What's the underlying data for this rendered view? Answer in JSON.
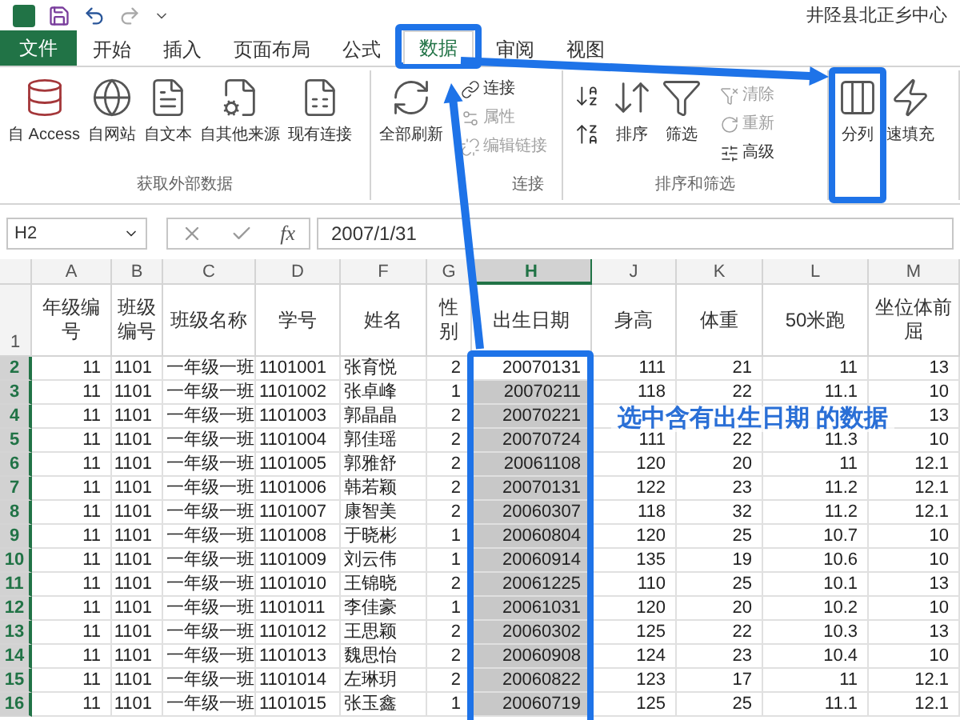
{
  "window": {
    "title": "井陉县北正乡中心"
  },
  "tabs": [
    {
      "label": "文件",
      "kind": "file",
      "selected": false,
      "highlighted": false
    },
    {
      "label": "开始",
      "kind": "tab",
      "selected": false,
      "highlighted": false
    },
    {
      "label": "插入",
      "kind": "tab",
      "selected": false,
      "highlighted": false
    },
    {
      "label": "页面布局",
      "kind": "tab",
      "selected": false,
      "highlighted": false
    },
    {
      "label": "公式",
      "kind": "tab",
      "selected": false,
      "highlighted": false
    },
    {
      "label": "数据",
      "kind": "tab",
      "selected": true,
      "highlighted": true
    },
    {
      "label": "审阅",
      "kind": "tab",
      "selected": false,
      "highlighted": false
    },
    {
      "label": "视图",
      "kind": "tab",
      "selected": false,
      "highlighted": false
    }
  ],
  "ribbon": [
    {
      "label": "获取外部数据",
      "items": [
        {
          "kind": "large",
          "label": "自 Access",
          "disabled": false,
          "highlighted": false
        },
        {
          "kind": "large",
          "label": "自网站",
          "disabled": false,
          "highlighted": false
        },
        {
          "kind": "large",
          "label": "自文本",
          "disabled": false,
          "highlighted": false
        },
        {
          "kind": "large",
          "label": "自其他来源",
          "disabled": false,
          "highlighted": false
        },
        {
          "kind": "large",
          "label": "现有连接",
          "disabled": false,
          "highlighted": false
        }
      ]
    },
    {
      "label": "连接",
      "items": [
        {
          "kind": "large",
          "label": "全部刷新",
          "disabled": false,
          "highlighted": false
        },
        {
          "kind": "small",
          "label": "连接",
          "disabled": false,
          "highlighted": false
        },
        {
          "kind": "small",
          "label": "属性",
          "disabled": true,
          "highlighted": false
        },
        {
          "kind": "small",
          "label": "编辑链接",
          "disabled": true,
          "highlighted": false
        }
      ]
    },
    {
      "label": "排序和筛选",
      "items": [
        {
          "kind": "sort",
          "disabled": false,
          "highlighted": false
        },
        {
          "kind": "large",
          "label": "排序",
          "disabled": false,
          "highlighted": false
        },
        {
          "kind": "large",
          "label": "筛选",
          "disabled": false,
          "highlighted": false
        },
        {
          "kind": "small",
          "label": "清除",
          "disabled": true,
          "highlighted": false
        },
        {
          "kind": "small",
          "label": "重新",
          "disabled": true,
          "highlighted": false
        },
        {
          "kind": "small",
          "label": "高级",
          "disabled": false,
          "highlighted": false
        }
      ]
    },
    {
      "items": [
        {
          "kind": "large",
          "label": "分列",
          "disabled": false,
          "highlighted": true
        },
        {
          "kind": "large",
          "label": "速填充",
          "disabled": false,
          "highlighted": false
        }
      ]
    }
  ],
  "formula_bar": {
    "name_box": "H2",
    "function_label": "fx",
    "value": "2007/1/31"
  },
  "header_row_num": "1",
  "columns": [
    {
      "letter": "A",
      "header": "年级编号",
      "selected": false,
      "highlighted": false
    },
    {
      "letter": "B",
      "header": "班级编号",
      "selected": false,
      "highlighted": false
    },
    {
      "letter": "C",
      "header": "班级名称",
      "selected": false,
      "highlighted": false
    },
    {
      "letter": "D",
      "header": "学号",
      "selected": false,
      "highlighted": false
    },
    {
      "letter": "F",
      "header": "姓名",
      "selected": false,
      "highlighted": false
    },
    {
      "letter": "G",
      "header": "性别",
      "selected": false,
      "highlighted": false
    },
    {
      "letter": "H",
      "header": "出生日期",
      "selected": true,
      "highlighted": true
    },
    {
      "letter": "J",
      "header": "身高",
      "selected": false,
      "highlighted": false
    },
    {
      "letter": "K",
      "header": "体重",
      "selected": false,
      "highlighted": false
    },
    {
      "letter": "L",
      "header": "50米跑",
      "selected": false,
      "highlighted": false
    },
    {
      "letter": "M",
      "header": "坐位体前屈",
      "selected": false,
      "highlighted": false
    }
  ],
  "rows": [
    {
      "num": "2",
      "selected": true,
      "active": true,
      "cells": [
        "11",
        "1101",
        "一年级一班",
        "1101001",
        "张育悦",
        "2",
        "20070131",
        "111",
        "21",
        "11",
        "13"
      ]
    },
    {
      "num": "3",
      "selected": true,
      "active": false,
      "cells": [
        "11",
        "1101",
        "一年级一班",
        "1101002",
        "张卓峰",
        "1",
        "20070211",
        "118",
        "22",
        "11.1",
        "10"
      ]
    },
    {
      "num": "4",
      "selected": true,
      "active": false,
      "cells": [
        "11",
        "1101",
        "一年级一班",
        "1101003",
        "郭晶晶",
        "2",
        "20070221",
        "",
        "",
        "",
        "13"
      ]
    },
    {
      "num": "5",
      "selected": true,
      "active": false,
      "cells": [
        "11",
        "1101",
        "一年级一班",
        "1101004",
        "郭佳瑶",
        "2",
        "20070724",
        "111",
        "22",
        "11.3",
        "10"
      ]
    },
    {
      "num": "6",
      "selected": true,
      "active": false,
      "cells": [
        "11",
        "1101",
        "一年级一班",
        "1101005",
        "郭雅舒",
        "2",
        "20061108",
        "120",
        "20",
        "11",
        "12.1"
      ]
    },
    {
      "num": "7",
      "selected": true,
      "active": false,
      "cells": [
        "11",
        "1101",
        "一年级一班",
        "1101006",
        "韩若颖",
        "2",
        "20070131",
        "122",
        "23",
        "11.2",
        "12.1"
      ]
    },
    {
      "num": "8",
      "selected": true,
      "active": false,
      "cells": [
        "11",
        "1101",
        "一年级一班",
        "1101007",
        "康智美",
        "2",
        "20060307",
        "118",
        "32",
        "11.2",
        "12.1"
      ]
    },
    {
      "num": "9",
      "selected": true,
      "active": false,
      "cells": [
        "11",
        "1101",
        "一年级一班",
        "1101008",
        "于晓彬",
        "1",
        "20060804",
        "120",
        "25",
        "10.7",
        "10"
      ]
    },
    {
      "num": "10",
      "selected": true,
      "active": false,
      "cells": [
        "11",
        "1101",
        "一年级一班",
        "1101009",
        "刘云伟",
        "1",
        "20060914",
        "135",
        "19",
        "10.6",
        "10"
      ]
    },
    {
      "num": "11",
      "selected": true,
      "active": false,
      "cells": [
        "11",
        "1101",
        "一年级一班",
        "1101010",
        "王锦晓",
        "2",
        "20061225",
        "110",
        "25",
        "10.1",
        "13"
      ]
    },
    {
      "num": "12",
      "selected": true,
      "active": false,
      "cells": [
        "11",
        "1101",
        "一年级一班",
        "1101011",
        "李佳豪",
        "1",
        "20061031",
        "120",
        "20",
        "10.2",
        "10"
      ]
    },
    {
      "num": "13",
      "selected": true,
      "active": false,
      "cells": [
        "11",
        "1101",
        "一年级一班",
        "1101012",
        "王思颖",
        "2",
        "20060302",
        "125",
        "22",
        "10.3",
        "13"
      ]
    },
    {
      "num": "14",
      "selected": true,
      "active": false,
      "cells": [
        "11",
        "1101",
        "一年级一班",
        "1101013",
        "魏思怡",
        "2",
        "20060908",
        "124",
        "23",
        "10.4",
        "10"
      ]
    },
    {
      "num": "15",
      "selected": true,
      "active": false,
      "cells": [
        "11",
        "1101",
        "一年级一班",
        "1101014",
        "左琳玥",
        "2",
        "20060822",
        "123",
        "17",
        "11",
        "12.1"
      ]
    },
    {
      "num": "16",
      "selected": true,
      "active": false,
      "cells": [
        "11",
        "1101",
        "一年级一班",
        "1101015",
        "张玉鑫",
        "1",
        "20060719",
        "125",
        "25",
        "11.1",
        "12.1"
      ]
    }
  ],
  "annotation": {
    "text": "选中含有出生日期 的数据"
  }
}
